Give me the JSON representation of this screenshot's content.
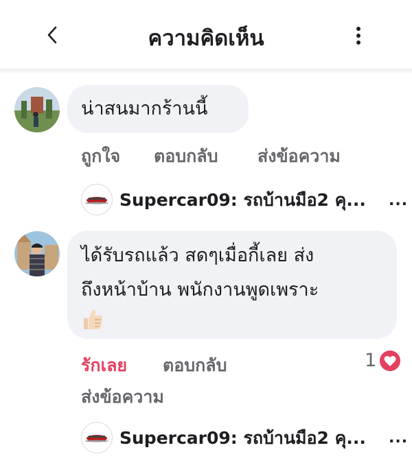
{
  "header": {
    "title": "ความคิดเห็น"
  },
  "comments": [
    {
      "text": "น่าสนมากร้านนี้",
      "actions": {
        "like": "ถูกใจ",
        "reply": "ตอบกลับ",
        "message": "ส่งข้อความ"
      },
      "reply_preview": {
        "text": "Supercar09: รถบ้านมือ2 คุ...",
        "more": "..."
      }
    },
    {
      "text_line1": "ได้รับรถแล้ว สดๆเมื่อกี้เลย ส่ง",
      "text_line2": "ถึงหน้าบ้าน พนักงานพูดเพราะ",
      "emoji": "thumbs-up-icon",
      "actions": {
        "like": "รักเลย",
        "reply": "ตอบกลับ",
        "message": "ส่งข้อความ"
      },
      "reaction": {
        "count": "1",
        "type": "heart"
      },
      "reply_preview": {
        "text": "Supercar09: รถบ้านมือ2 คุ...",
        "more": "..."
      }
    }
  ],
  "colors": {
    "love": "#e4405f",
    "muted": "#65676b",
    "bubble": "#f0f2f5"
  }
}
